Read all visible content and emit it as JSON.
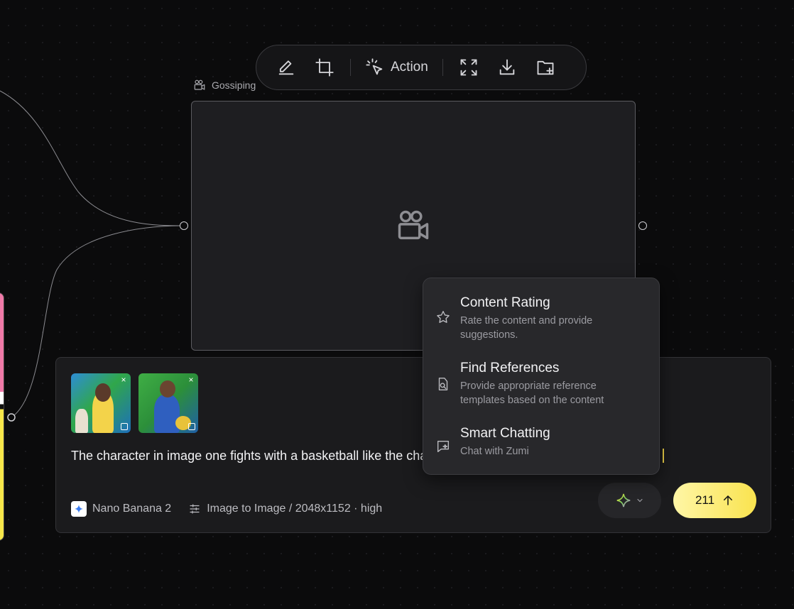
{
  "toolbar": {
    "action_label": "Action",
    "icons": [
      "edit-pencil-icon",
      "crop-icon",
      "cursor-click-icon",
      "expand-icon",
      "download-icon",
      "folder-plus-icon"
    ]
  },
  "node": {
    "label": "Gossiping",
    "icon": "video-camera-icon"
  },
  "prompt": {
    "text": "The character in image one fights with a basketball like the character in image two on a basketball court.",
    "attachments": [
      {
        "kind": "image",
        "remove_label": "×"
      },
      {
        "kind": "image",
        "remove_label": "×"
      }
    ],
    "model": "Nano Banana 2",
    "mode": "Image to Image / 2048x1152 · high",
    "credits": "211"
  },
  "menu": {
    "items": [
      {
        "title": "Content Rating",
        "desc": "Rate the content and provide suggestions.",
        "icon": "star-icon"
      },
      {
        "title": "Find References",
        "desc": "Provide appropriate reference templates based on the content",
        "icon": "search-doc-icon"
      },
      {
        "title": "Smart Chatting",
        "desc": "Chat with Zumi",
        "icon": "chat-sparkle-icon"
      }
    ]
  },
  "colors": {
    "accent_yellow": "#f9e34f",
    "background": "#0b0b0c",
    "panel": "#1b1b1d"
  }
}
